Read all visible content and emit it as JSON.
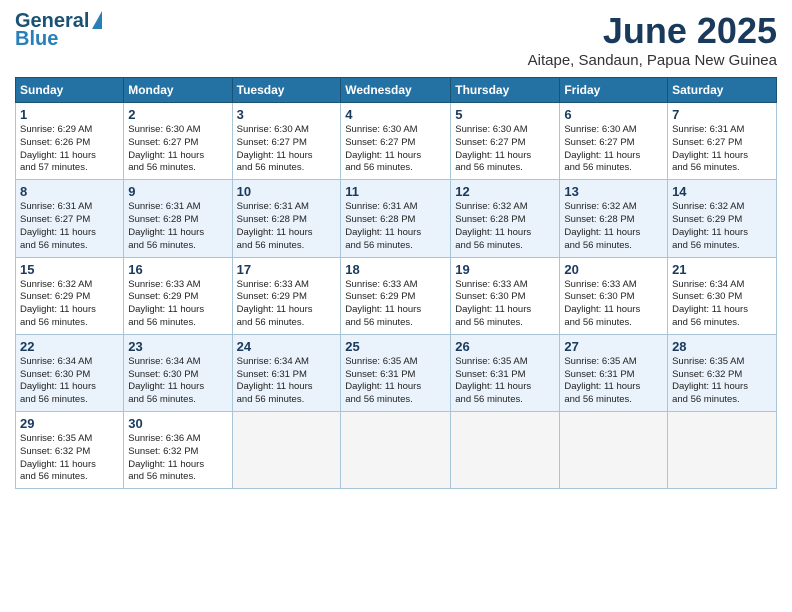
{
  "logo": {
    "line1": "General",
    "line2": "Blue"
  },
  "title": "June 2025",
  "subtitle": "Aitape, Sandaun, Papua New Guinea",
  "days_of_week": [
    "Sunday",
    "Monday",
    "Tuesday",
    "Wednesday",
    "Thursday",
    "Friday",
    "Saturday"
  ],
  "weeks": [
    [
      {
        "day": "1",
        "info": "Sunrise: 6:29 AM\nSunset: 6:26 PM\nDaylight: 11 hours\nand 57 minutes."
      },
      {
        "day": "2",
        "info": "Sunrise: 6:30 AM\nSunset: 6:27 PM\nDaylight: 11 hours\nand 56 minutes."
      },
      {
        "day": "3",
        "info": "Sunrise: 6:30 AM\nSunset: 6:27 PM\nDaylight: 11 hours\nand 56 minutes."
      },
      {
        "day": "4",
        "info": "Sunrise: 6:30 AM\nSunset: 6:27 PM\nDaylight: 11 hours\nand 56 minutes."
      },
      {
        "day": "5",
        "info": "Sunrise: 6:30 AM\nSunset: 6:27 PM\nDaylight: 11 hours\nand 56 minutes."
      },
      {
        "day": "6",
        "info": "Sunrise: 6:30 AM\nSunset: 6:27 PM\nDaylight: 11 hours\nand 56 minutes."
      },
      {
        "day": "7",
        "info": "Sunrise: 6:31 AM\nSunset: 6:27 PM\nDaylight: 11 hours\nand 56 minutes."
      }
    ],
    [
      {
        "day": "8",
        "info": "Sunrise: 6:31 AM\nSunset: 6:27 PM\nDaylight: 11 hours\nand 56 minutes."
      },
      {
        "day": "9",
        "info": "Sunrise: 6:31 AM\nSunset: 6:28 PM\nDaylight: 11 hours\nand 56 minutes."
      },
      {
        "day": "10",
        "info": "Sunrise: 6:31 AM\nSunset: 6:28 PM\nDaylight: 11 hours\nand 56 minutes."
      },
      {
        "day": "11",
        "info": "Sunrise: 6:31 AM\nSunset: 6:28 PM\nDaylight: 11 hours\nand 56 minutes."
      },
      {
        "day": "12",
        "info": "Sunrise: 6:32 AM\nSunset: 6:28 PM\nDaylight: 11 hours\nand 56 minutes."
      },
      {
        "day": "13",
        "info": "Sunrise: 6:32 AM\nSunset: 6:28 PM\nDaylight: 11 hours\nand 56 minutes."
      },
      {
        "day": "14",
        "info": "Sunrise: 6:32 AM\nSunset: 6:29 PM\nDaylight: 11 hours\nand 56 minutes."
      }
    ],
    [
      {
        "day": "15",
        "info": "Sunrise: 6:32 AM\nSunset: 6:29 PM\nDaylight: 11 hours\nand 56 minutes."
      },
      {
        "day": "16",
        "info": "Sunrise: 6:33 AM\nSunset: 6:29 PM\nDaylight: 11 hours\nand 56 minutes."
      },
      {
        "day": "17",
        "info": "Sunrise: 6:33 AM\nSunset: 6:29 PM\nDaylight: 11 hours\nand 56 minutes."
      },
      {
        "day": "18",
        "info": "Sunrise: 6:33 AM\nSunset: 6:29 PM\nDaylight: 11 hours\nand 56 minutes."
      },
      {
        "day": "19",
        "info": "Sunrise: 6:33 AM\nSunset: 6:30 PM\nDaylight: 11 hours\nand 56 minutes."
      },
      {
        "day": "20",
        "info": "Sunrise: 6:33 AM\nSunset: 6:30 PM\nDaylight: 11 hours\nand 56 minutes."
      },
      {
        "day": "21",
        "info": "Sunrise: 6:34 AM\nSunset: 6:30 PM\nDaylight: 11 hours\nand 56 minutes."
      }
    ],
    [
      {
        "day": "22",
        "info": "Sunrise: 6:34 AM\nSunset: 6:30 PM\nDaylight: 11 hours\nand 56 minutes."
      },
      {
        "day": "23",
        "info": "Sunrise: 6:34 AM\nSunset: 6:30 PM\nDaylight: 11 hours\nand 56 minutes."
      },
      {
        "day": "24",
        "info": "Sunrise: 6:34 AM\nSunset: 6:31 PM\nDaylight: 11 hours\nand 56 minutes."
      },
      {
        "day": "25",
        "info": "Sunrise: 6:35 AM\nSunset: 6:31 PM\nDaylight: 11 hours\nand 56 minutes."
      },
      {
        "day": "26",
        "info": "Sunrise: 6:35 AM\nSunset: 6:31 PM\nDaylight: 11 hours\nand 56 minutes."
      },
      {
        "day": "27",
        "info": "Sunrise: 6:35 AM\nSunset: 6:31 PM\nDaylight: 11 hours\nand 56 minutes."
      },
      {
        "day": "28",
        "info": "Sunrise: 6:35 AM\nSunset: 6:32 PM\nDaylight: 11 hours\nand 56 minutes."
      }
    ],
    [
      {
        "day": "29",
        "info": "Sunrise: 6:35 AM\nSunset: 6:32 PM\nDaylight: 11 hours\nand 56 minutes."
      },
      {
        "day": "30",
        "info": "Sunrise: 6:36 AM\nSunset: 6:32 PM\nDaylight: 11 hours\nand 56 minutes."
      },
      {
        "day": "",
        "info": ""
      },
      {
        "day": "",
        "info": ""
      },
      {
        "day": "",
        "info": ""
      },
      {
        "day": "",
        "info": ""
      },
      {
        "day": "",
        "info": ""
      }
    ]
  ]
}
